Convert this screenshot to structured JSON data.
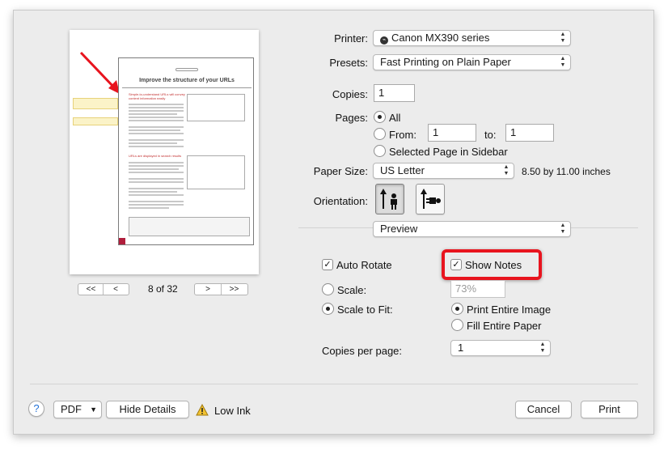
{
  "printer": {
    "label": "Printer:",
    "value": "Canon MX390 series"
  },
  "presets": {
    "label": "Presets:",
    "value": "Fast Printing on Plain Paper"
  },
  "copies": {
    "label": "Copies:",
    "value": "1"
  },
  "pages": {
    "label": "Pages:",
    "all_label": "All",
    "from_label": "From:",
    "from_value": "1",
    "to_label": "to:",
    "to_value": "1",
    "selected_label": "Selected Page in Sidebar"
  },
  "paper_size": {
    "label": "Paper Size:",
    "value": "US Letter",
    "dimensions": "8.50 by 11.00 inches"
  },
  "orientation": {
    "label": "Orientation:"
  },
  "section": {
    "value": "Preview"
  },
  "options": {
    "auto_rotate": "Auto Rotate",
    "show_notes": "Show Notes",
    "scale_label": "Scale:",
    "scale_value": "73%",
    "scale_to_fit": "Scale to Fit:",
    "print_entire_image": "Print Entire Image",
    "fill_entire_paper": "Fill Entire Paper",
    "copies_per_page_label": "Copies per page:",
    "copies_per_page_value": "1"
  },
  "navigation": {
    "page_indicator": "8 of 32",
    "first": "<<",
    "prev": "<",
    "next": ">",
    "last": ">>"
  },
  "preview_doc": {
    "title": "Improve the structure of your URLs",
    "heading1": "Simple-to-understand URLs will convey content information easily",
    "heading2": "URLs are displayed in search results"
  },
  "footer": {
    "help": "?",
    "pdf": "PDF",
    "hide_details": "Hide Details",
    "low_ink": "Low Ink",
    "cancel": "Cancel",
    "print": "Print"
  },
  "colors": {
    "highlight": "#e8141e",
    "dialog_bg": "#ececec"
  }
}
